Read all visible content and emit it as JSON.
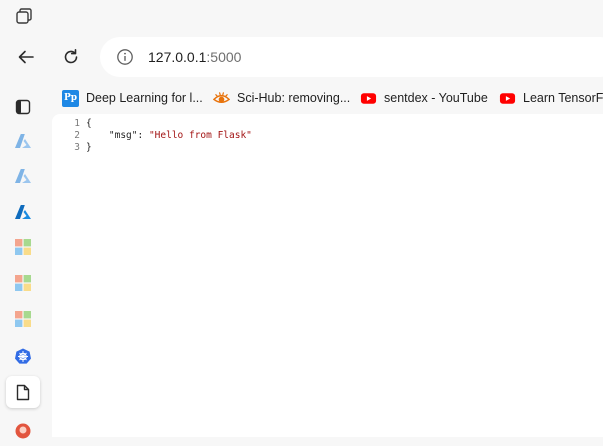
{
  "address_bar": {
    "host": "127.0.0.1",
    "port": ":5000"
  },
  "bookmarks": [
    {
      "label": "Deep Learning for l...",
      "icon": "pp-icon",
      "icon_text": "Pp"
    },
    {
      "label": "Sci-Hub: removing...",
      "icon": "scihub-eye-icon"
    },
    {
      "label": "sentdex - YouTube",
      "icon": "youtube-icon"
    },
    {
      "label": "Learn TensorFlo",
      "icon": "youtube-icon"
    }
  ],
  "sidebar": [
    {
      "name": "tab-actions-icon"
    },
    {
      "name": "azure-icon"
    },
    {
      "name": "azure-icon"
    },
    {
      "name": "azure-icon"
    },
    {
      "name": "microsoft-icon"
    },
    {
      "name": "microsoft-icon"
    },
    {
      "name": "microsoft-icon"
    },
    {
      "name": "kubernetes-icon"
    },
    {
      "name": "file-icon"
    },
    {
      "name": "app-icon"
    }
  ],
  "json_view": {
    "lines": [
      {
        "num": "1",
        "text": "{"
      },
      {
        "num": "2",
        "indent": "    ",
        "key": "\"msg\"",
        "sep": ": ",
        "value": "\"Hello from Flask\""
      },
      {
        "num": "3",
        "text": "}"
      }
    ]
  },
  "colors": {
    "chrome_bg": "#f7f7f7",
    "json_string": "#a31515",
    "youtube_red": "#ff0000",
    "azure_blue": "#0f6cbd"
  }
}
